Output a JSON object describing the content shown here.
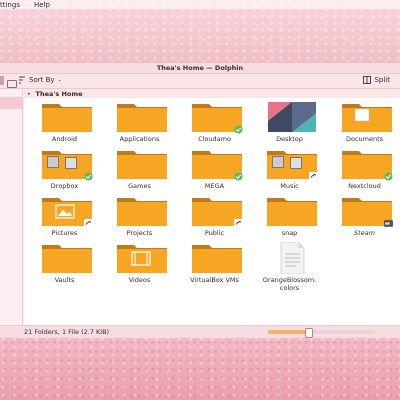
{
  "menu": {
    "items": [
      "ttings",
      "Help"
    ]
  },
  "window": {
    "title": "Thea's Home — Dolphin"
  },
  "toolbar": {
    "sort_label": "Sort By",
    "split_label": "Split"
  },
  "breadcrumb": {
    "label": "Thea's Home"
  },
  "items": [
    {
      "label": "Android",
      "type": "folder",
      "badge": ""
    },
    {
      "label": "Applications",
      "type": "folder",
      "badge": ""
    },
    {
      "label": "Cloudamo",
      "type": "folder",
      "badge": "check"
    },
    {
      "label": "Desktop",
      "type": "desktop",
      "badge": ""
    },
    {
      "label": "Documents",
      "type": "folder-doc",
      "badge": ""
    },
    {
      "label": "Dropbox",
      "type": "folder-photo",
      "badge": "check"
    },
    {
      "label": "Games",
      "type": "folder",
      "badge": ""
    },
    {
      "label": "MEGA",
      "type": "folder",
      "badge": "check"
    },
    {
      "label": "Music",
      "type": "folder-photo",
      "badge": "link"
    },
    {
      "label": "Nextcloud",
      "type": "folder",
      "badge": "check"
    },
    {
      "label": "Pictures",
      "type": "folder-pic",
      "badge": "link"
    },
    {
      "label": "Projects",
      "type": "folder",
      "badge": ""
    },
    {
      "label": "Public",
      "type": "folder",
      "badge": "link"
    },
    {
      "label": "snap",
      "type": "folder",
      "badge": ""
    },
    {
      "label": "Steam",
      "type": "folder",
      "badge": "drive",
      "italic": true
    },
    {
      "label": "Vaults",
      "type": "folder",
      "badge": ""
    },
    {
      "label": "Videos",
      "type": "folder-film",
      "badge": ""
    },
    {
      "label": "VirtualBox VMs",
      "type": "folder",
      "badge": ""
    },
    {
      "label": "OrangeBlossom.\ncolors",
      "type": "file",
      "badge": ""
    }
  ],
  "status": {
    "text": "21 Folders, 1 File (2.7 KiB)",
    "zoom_fraction": 0.37
  },
  "colors": {
    "folder": "#f6a623",
    "folder_dark": "#c07a1c",
    "check": "#5cb85c",
    "accent": "#f5b26b"
  }
}
